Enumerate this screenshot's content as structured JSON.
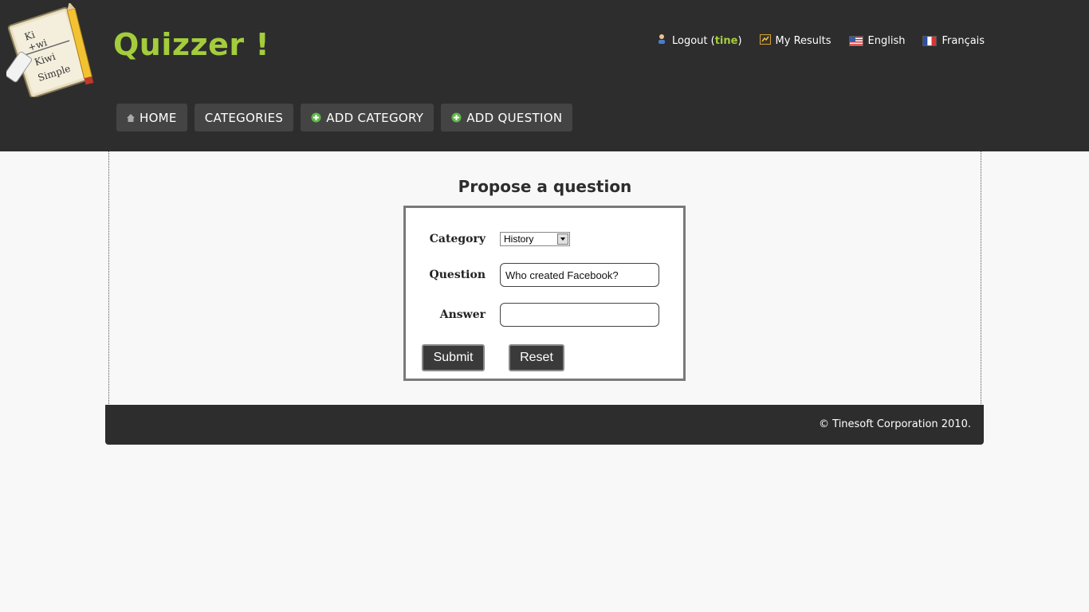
{
  "site": {
    "title": "Quizzer !"
  },
  "toplinks": {
    "logout_label": "Logout (",
    "username": "tine",
    "logout_close": ")",
    "my_results": "My Results",
    "english": "English",
    "french": "Français"
  },
  "nav": {
    "home": "HOME",
    "categories": "CATEGORIES",
    "add_category": "ADD CATEGORY",
    "add_question": "ADD QUESTION"
  },
  "form": {
    "title": "Propose a question",
    "category_label": "Category",
    "category_value": "History",
    "question_label": "Question",
    "question_value": "Who created Facebook?",
    "answer_label": "Answer",
    "answer_value": "",
    "submit": "Submit",
    "reset": "Reset"
  },
  "footer": {
    "copyright": "© Tinesoft Corporation 2010."
  },
  "colors": {
    "accent": "#a3cd3b",
    "header_bg": "#2d2d2d",
    "nav_bg": "#444444"
  }
}
